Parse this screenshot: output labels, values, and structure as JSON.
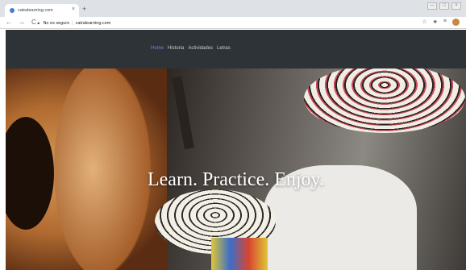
{
  "browser": {
    "tab_title": "catralearning.com",
    "tab_close": "×",
    "new_tab": "+",
    "address_security": "No es seguro",
    "address_url": "catralearning.com",
    "nav_back": "←",
    "nav_forward": "→",
    "nav_reload": "C",
    "win_controls": [
      "—",
      "□",
      "×"
    ],
    "tools": [
      "☆",
      "★",
      "≡"
    ]
  },
  "site": {
    "menu": [
      {
        "label": "Home",
        "active": true
      },
      {
        "label": "Historia",
        "active": false
      },
      {
        "label": "Actividades",
        "active": false
      },
      {
        "label": "Letras",
        "active": false
      }
    ],
    "hero_tagline": "Learn. Practice. Enjoy."
  },
  "colors": {
    "header_bg": "#2e3338",
    "menu_active": "#5b8fe0",
    "menu_text": "#c9cdd1"
  }
}
